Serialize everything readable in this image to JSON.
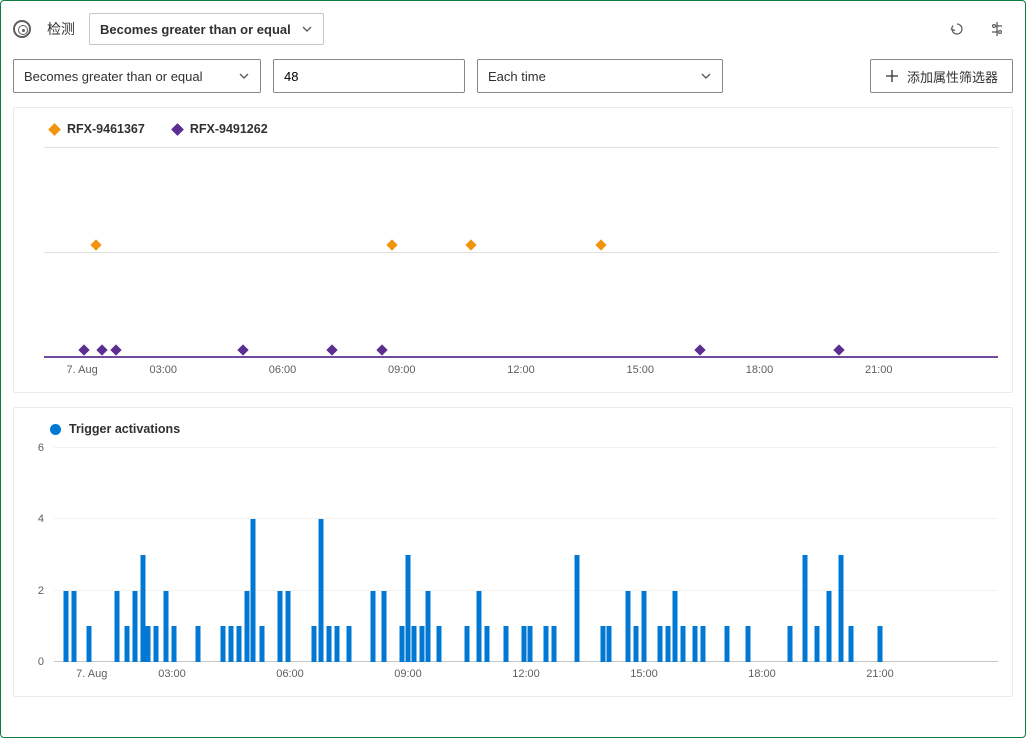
{
  "header": {
    "label": "检测",
    "type_select": "Becomes greater than or equal"
  },
  "toolbar": {
    "undo": "undo",
    "settings": "settings"
  },
  "controls": {
    "condition": "Becomes greater than or equal",
    "value": "48",
    "frequency": "Each time",
    "add_filter": "添加属性筛选器"
  },
  "chart_data": [
    {
      "type": "scatter",
      "series": [
        {
          "name": "RFX-9461367",
          "color": "#f2930d",
          "points": [
            [
              1.3,
              1
            ],
            [
              8.75,
              1
            ],
            [
              10.75,
              1
            ],
            [
              14.0,
              1
            ]
          ]
        },
        {
          "name": "RFX-9491262",
          "color": "#5c2e91",
          "points": [
            [
              1.0,
              0
            ],
            [
              1.45,
              0
            ],
            [
              1.8,
              0
            ],
            [
              5.0,
              0
            ],
            [
              7.25,
              0
            ],
            [
              8.5,
              0
            ],
            [
              16.5,
              0
            ],
            [
              20.0,
              0
            ]
          ]
        }
      ],
      "x_start_label": "7. Aug",
      "x_ticks": [
        "03:00",
        "06:00",
        "09:00",
        "12:00",
        "15:00",
        "18:00",
        "21:00"
      ],
      "x_range_hours": 24,
      "ylim": [
        0,
        2
      ],
      "gridlines_y": [
        0,
        1,
        2
      ]
    },
    {
      "type": "bar",
      "title": "Trigger activations",
      "x_start_label": "7. Aug",
      "x_ticks": [
        "03:00",
        "06:00",
        "09:00",
        "12:00",
        "15:00",
        "18:00",
        "21:00"
      ],
      "x_range_hours": 24,
      "ylim": [
        0,
        6
      ],
      "y_ticks": [
        0,
        2,
        4,
        6
      ],
      "values": [
        [
          0.3,
          2
        ],
        [
          0.5,
          2
        ],
        [
          0.9,
          1
        ],
        [
          1.6,
          2
        ],
        [
          1.85,
          1
        ],
        [
          2.05,
          2
        ],
        [
          2.25,
          3
        ],
        [
          2.4,
          1
        ],
        [
          2.6,
          1
        ],
        [
          2.85,
          2
        ],
        [
          3.05,
          1
        ],
        [
          3.65,
          1
        ],
        [
          4.3,
          1
        ],
        [
          4.5,
          1
        ],
        [
          4.7,
          1
        ],
        [
          4.9,
          2
        ],
        [
          5.05,
          4
        ],
        [
          5.3,
          1
        ],
        [
          5.75,
          2
        ],
        [
          5.95,
          2
        ],
        [
          6.6,
          1
        ],
        [
          6.8,
          4
        ],
        [
          7.0,
          1
        ],
        [
          7.2,
          1
        ],
        [
          7.5,
          1
        ],
        [
          8.1,
          2
        ],
        [
          8.4,
          2
        ],
        [
          8.85,
          1
        ],
        [
          9.0,
          3
        ],
        [
          9.15,
          1
        ],
        [
          9.35,
          1
        ],
        [
          9.5,
          2
        ],
        [
          9.8,
          1
        ],
        [
          10.5,
          1
        ],
        [
          10.8,
          2
        ],
        [
          11.0,
          1
        ],
        [
          11.5,
          1
        ],
        [
          11.95,
          1
        ],
        [
          12.1,
          1
        ],
        [
          12.5,
          1
        ],
        [
          12.7,
          1
        ],
        [
          13.3,
          3
        ],
        [
          13.95,
          1
        ],
        [
          14.1,
          1
        ],
        [
          14.6,
          2
        ],
        [
          14.8,
          1
        ],
        [
          15.0,
          2
        ],
        [
          15.4,
          1
        ],
        [
          15.6,
          1
        ],
        [
          15.8,
          2
        ],
        [
          16.0,
          1
        ],
        [
          16.3,
          1
        ],
        [
          16.5,
          1
        ],
        [
          17.1,
          1
        ],
        [
          17.65,
          1
        ],
        [
          18.7,
          1
        ],
        [
          19.1,
          3
        ],
        [
          19.4,
          1
        ],
        [
          19.7,
          2
        ],
        [
          20.0,
          3
        ],
        [
          20.25,
          1
        ],
        [
          21.0,
          1
        ]
      ]
    }
  ]
}
